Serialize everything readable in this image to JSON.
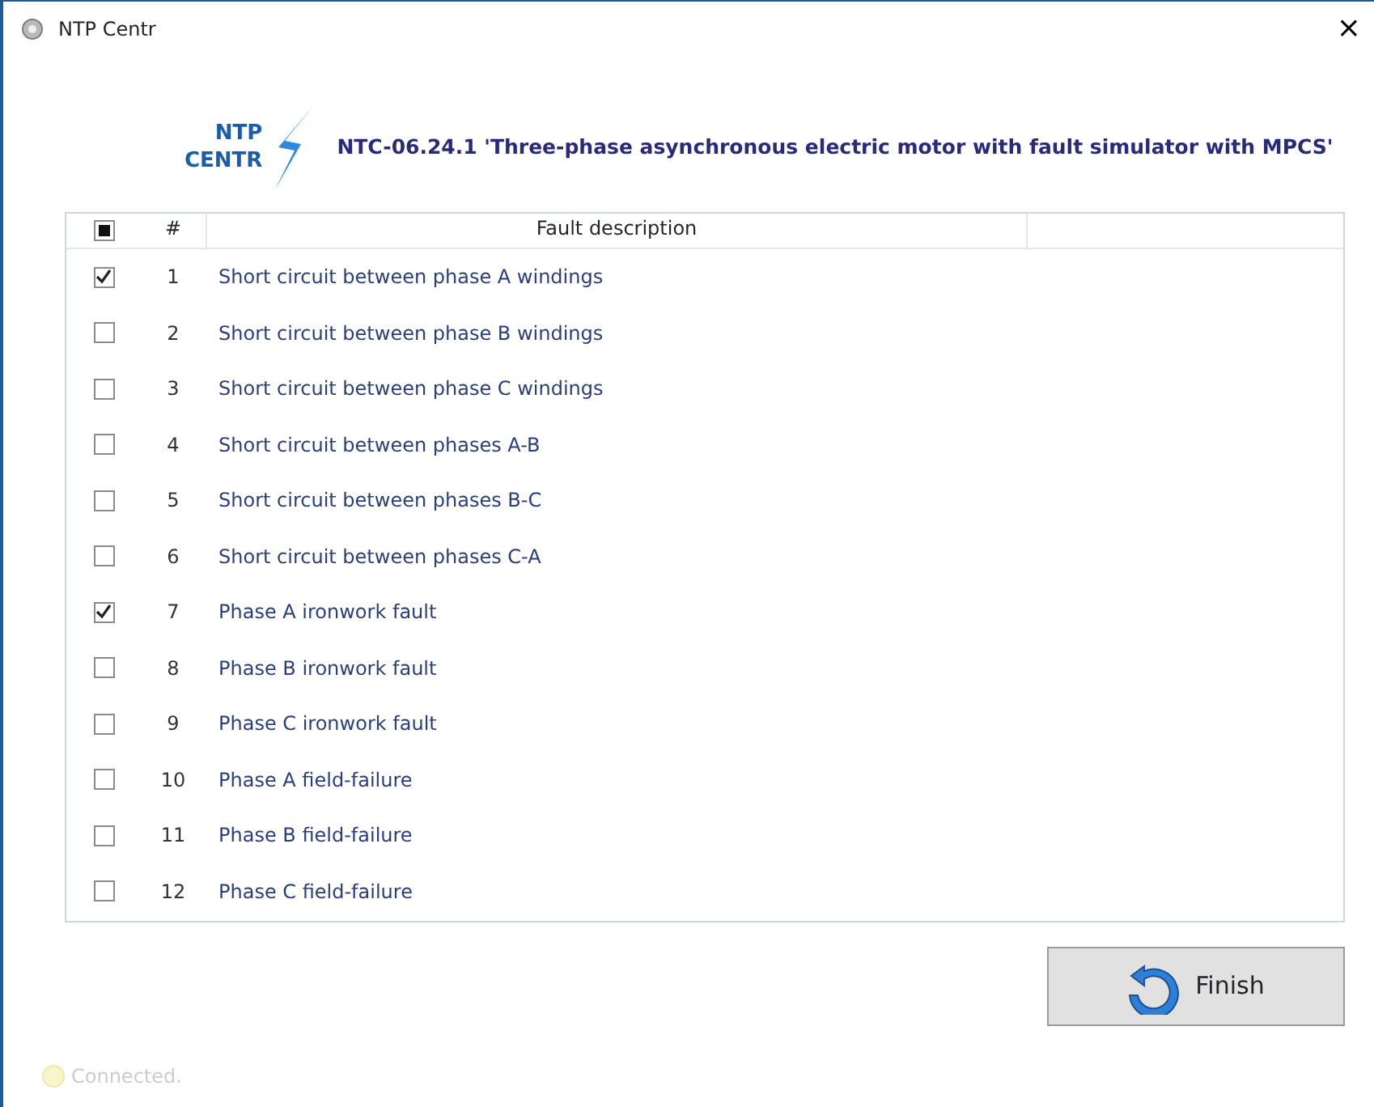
{
  "window": {
    "title": "NTP Centr",
    "close": "×"
  },
  "header": {
    "logo_top": "NTP",
    "logo_bottom": "CENTR",
    "title": "NTC-06.24.1 'Three-phase asynchronous electric motor with fault simulator with MPCS'"
  },
  "table": {
    "select_all": {
      "partial": true
    },
    "columns": [
      "#",
      "Fault description"
    ],
    "rows": [
      {
        "number": "1",
        "description": "Short circuit between phase A windings",
        "checked": true
      },
      {
        "number": "2",
        "description": "Short circuit between phase B windings",
        "checked": false
      },
      {
        "number": "3",
        "description": "Short circuit between phase C windings",
        "checked": false
      },
      {
        "number": "4",
        "description": "Short circuit between phases A-B",
        "checked": false
      },
      {
        "number": "5",
        "description": "Short circuit between phases B-C",
        "checked": false
      },
      {
        "number": "6",
        "description": "Short circuit between phases C-A",
        "checked": false
      },
      {
        "number": "7",
        "description": "Phase A ironwork fault",
        "checked": true
      },
      {
        "number": "8",
        "description": "Phase B ironwork fault",
        "checked": false
      },
      {
        "number": "9",
        "description": "Phase C ironwork fault",
        "checked": false
      },
      {
        "number": "10",
        "description": "Phase A field-failure",
        "checked": false
      },
      {
        "number": "11",
        "description": "Phase B field-failure",
        "checked": false
      },
      {
        "number": "12",
        "description": "Phase C field-failure",
        "checked": false
      }
    ]
  },
  "finish_button": "Finish",
  "status": "Connected."
}
